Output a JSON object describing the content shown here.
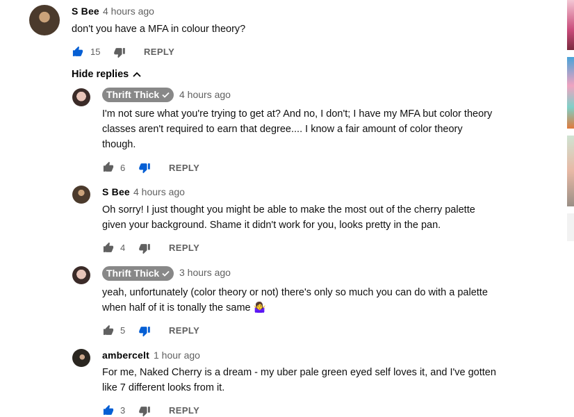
{
  "thread": {
    "author": "S Bee",
    "time": "4 hours ago",
    "text": "don't you have a MFA in colour theory?",
    "likes": "15",
    "reply_label": "REPLY",
    "hide_replies_label": "Hide replies"
  },
  "replies": [
    {
      "author": "Thrift Thick",
      "verified": true,
      "time": "4 hours ago",
      "text_line1": "I'm not sure what you're trying to get at? And no, I don't; I have my MFA but color theory",
      "text_line2": "classes aren't required to earn that degree.... I know a fair amount of color theory",
      "text_line3": "though.",
      "likes": "6",
      "reply_label": "REPLY",
      "disliked": true
    },
    {
      "author": "S Bee",
      "verified": false,
      "time": "4 hours ago",
      "text_line1": "Oh sorry! I just thought you might be able to make the most out of the cherry palette",
      "text_line2": "given your background. Shame it didn't work for you, looks pretty in the pan.",
      "likes": "4",
      "reply_label": "REPLY",
      "disliked": false
    },
    {
      "author": "Thrift Thick",
      "verified": true,
      "time": "3 hours ago",
      "text_line1": "yeah, unfortunately (color theory or not) there's only so much you can do with a palette",
      "text_line2": "when half of it is tonally the same",
      "emoji": "🤷‍♀️",
      "likes": "5",
      "reply_label": "REPLY",
      "disliked": true
    },
    {
      "author": "ambercelt",
      "verified": false,
      "time": "1 hour ago",
      "text_line1": "For me, Naked Cherry is a dream - my uber pale green eyed self loves it, and I've gotten",
      "text_line2": "like 7 different looks from it.",
      "likes": "3",
      "reply_label": "REPLY",
      "disliked": false
    }
  ],
  "colors": {
    "accent": "#065fd4",
    "badge": "#888888",
    "muted": "#606060"
  }
}
